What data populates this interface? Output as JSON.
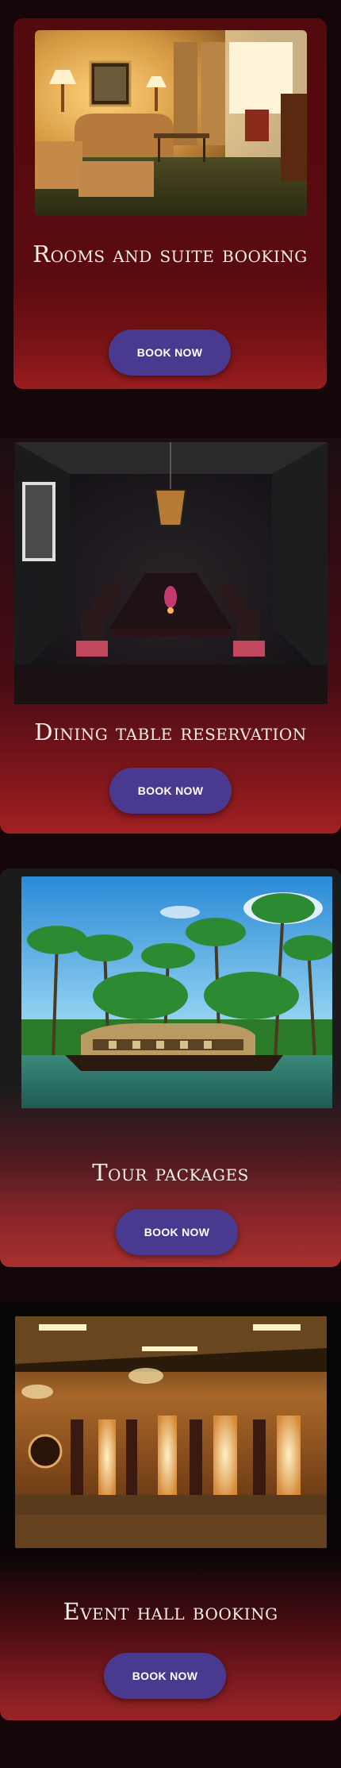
{
  "cards": [
    {
      "title": "Rooms and suite booking",
      "button_label": "BOOK NOW",
      "image": "hotel-room-photo"
    },
    {
      "title": "Dining table reservation",
      "button_label": "BOOK NOW",
      "image": "dining-room-photo"
    },
    {
      "title": "Tour packages",
      "button_label": "BOOK NOW",
      "image": "houseboat-backwaters-photo"
    },
    {
      "title": "Event hall booking",
      "button_label": "BOOK NOW",
      "image": "banquet-hall-photo"
    }
  ],
  "colors": {
    "button": "#4a3a8f",
    "card_red": "#9b1d20",
    "background": "#140609"
  }
}
